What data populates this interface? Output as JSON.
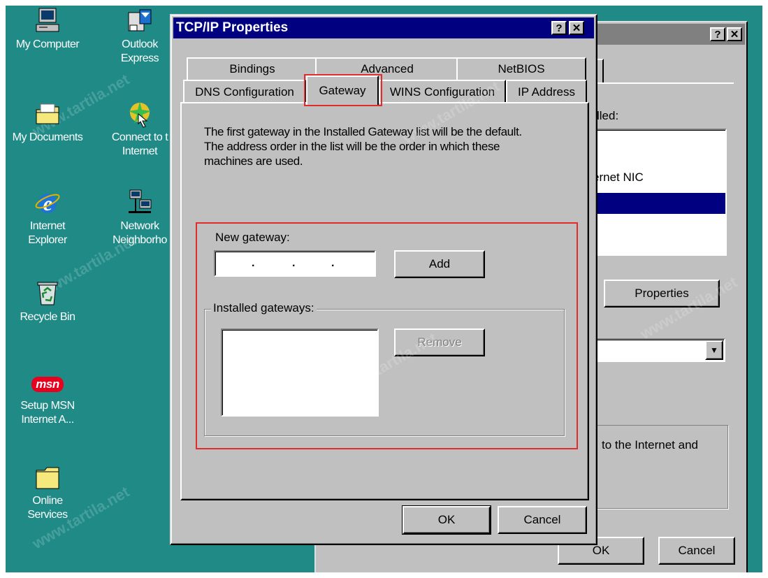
{
  "desktop_icons": [
    {
      "id": "my-computer",
      "lines": [
        "My Computer"
      ],
      "icon": "computer-icon"
    },
    {
      "id": "outlook-express",
      "lines": [
        "Outlook",
        "Express"
      ],
      "icon": "outlook-icon"
    },
    {
      "id": "my-documents",
      "lines": [
        "My Documents"
      ],
      "icon": "folder-documents-icon"
    },
    {
      "id": "connect-internet",
      "lines": [
        "Connect to t",
        "Internet"
      ],
      "icon": "connect-wizard-icon"
    },
    {
      "id": "internet-explorer",
      "lines": [
        "Internet",
        "Explorer"
      ],
      "icon": "internet-explorer-icon"
    },
    {
      "id": "network-neighborhood",
      "lines": [
        "Network",
        "Neighborho"
      ],
      "icon": "network-icon"
    },
    {
      "id": "recycle-bin",
      "lines": [
        "Recycle Bin"
      ],
      "icon": "recycle-bin-icon"
    },
    {
      "id": "setup-msn",
      "lines": [
        "Setup MSN",
        "Internet A..."
      ],
      "icon": "msn-icon"
    },
    {
      "id": "online-services",
      "lines": [
        "Online",
        "Services"
      ],
      "icon": "folder-icon"
    }
  ],
  "msn_text": "msn",
  "background_window": {
    "help_glyph": "?",
    "close_glyph": "✕",
    "list_label_fragment": "lled:",
    "list_item_fragment": "ernet NIC",
    "properties_button": "Properties",
    "description_fragment": "to the Internet and",
    "ok_button": "OK",
    "cancel_button": "Cancel"
  },
  "dialog": {
    "title": "TCP/IP Properties",
    "help_glyph": "?",
    "close_glyph": "✕",
    "tabs_row1": [
      "Bindings",
      "Advanced",
      "NetBIOS"
    ],
    "tabs_row2": [
      "DNS Configuration",
      "Gateway",
      "WINS Configuration",
      "IP Address"
    ],
    "active_tab": "Gateway",
    "description": [
      "The first gateway in the Installed Gateway list will be the default.",
      "The address order in the list will be the order in which these",
      "machines are used."
    ],
    "new_gateway_label": "New gateway:",
    "ip_dots": [
      ".",
      ".",
      "."
    ],
    "add_button": "Add",
    "installed_label": "Installed gateways:",
    "remove_button": "Remove",
    "ok_button": "OK",
    "cancel_button": "Cancel"
  },
  "watermark": "www.tartila.net",
  "colors": {
    "desktop": "#1f8a86",
    "title_active": "#000080",
    "title_inactive": "#808080",
    "face": "#c0c0c0",
    "highlight_box": "#e32b2b",
    "selection": "#000080"
  }
}
